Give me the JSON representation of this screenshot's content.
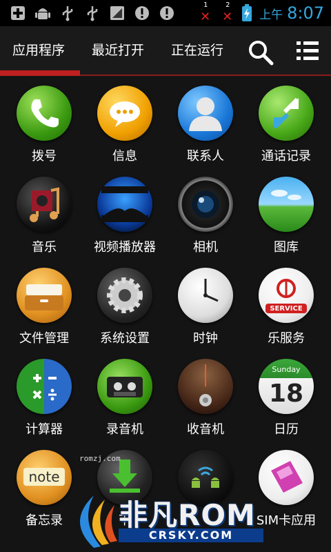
{
  "status_bar": {
    "icons": [
      "add-notification-icon",
      "android-icon",
      "usb-icon",
      "usb-icon",
      "no-signal-icon",
      "alert-icon",
      "alert-icon"
    ],
    "sim1_label": "1",
    "sim2_label": "2",
    "am_pm": "上午",
    "time": "8:07"
  },
  "tabs": {
    "apps": "应用程序",
    "recent": "最近打开",
    "running": "正在运行"
  },
  "apps": [
    {
      "label": "拨号"
    },
    {
      "label": "信息"
    },
    {
      "label": "联系人"
    },
    {
      "label": "通话记录"
    },
    {
      "label": "音乐"
    },
    {
      "label": "视频播放器"
    },
    {
      "label": "相机"
    },
    {
      "label": "图库"
    },
    {
      "label": "文件管理"
    },
    {
      "label": "系统设置"
    },
    {
      "label": "时钟"
    },
    {
      "label": "乐服务"
    },
    {
      "label": "计算器"
    },
    {
      "label": "录音机"
    },
    {
      "label": "收音机"
    },
    {
      "label": "日历"
    },
    {
      "label": "备忘录"
    },
    {
      "label": "下"
    },
    {
      "label": ""
    },
    {
      "label": "SIM卡应用"
    }
  ],
  "icon_text": {
    "note": "note",
    "calendar_day": "Sunday",
    "calendar_date": "18",
    "service": "SERVICE"
  },
  "watermark": {
    "small": "romzj.com",
    "brand": "非凡ROM",
    "site": "CRSKY.COM"
  },
  "colors": {
    "accent_red": "#c02020",
    "clock_blue": "#35a8e0"
  }
}
